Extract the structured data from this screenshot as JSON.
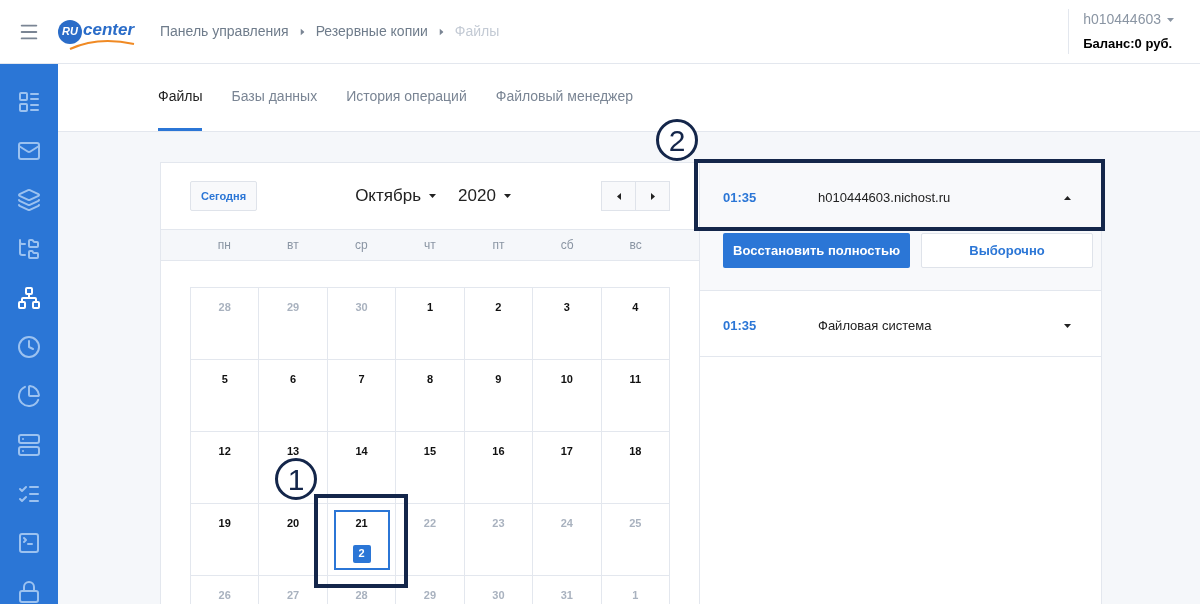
{
  "header": {
    "logo": {
      "badge": "RU",
      "word": "center"
    },
    "breadcrumbs": [
      {
        "label": "Панель управления",
        "current": false
      },
      {
        "label": "Резервные копии",
        "current": false
      },
      {
        "label": "Файлы",
        "current": true
      }
    ],
    "account": {
      "login": "h010444603",
      "balance": "Баланс:0 руб."
    }
  },
  "sidebar": {
    "items": [
      {
        "kind": "list",
        "selected": false
      },
      {
        "kind": "mail",
        "selected": false
      },
      {
        "kind": "layers",
        "selected": false
      },
      {
        "kind": "folder",
        "selected": false
      },
      {
        "kind": "network",
        "selected": true
      },
      {
        "kind": "clock",
        "selected": false
      },
      {
        "kind": "pie",
        "selected": false
      },
      {
        "kind": "server",
        "selected": false
      },
      {
        "kind": "form",
        "selected": false
      },
      {
        "kind": "terminal",
        "selected": false
      },
      {
        "kind": "lock",
        "selected": false
      }
    ]
  },
  "tabs": [
    {
      "label": "Файлы",
      "selected": true
    },
    {
      "label": "Базы данных",
      "selected": false
    },
    {
      "label": "История операций",
      "selected": false
    },
    {
      "label": "Файловый менеджер",
      "selected": false
    }
  ],
  "calendar": {
    "today_button": "Сегодня",
    "month": "Октябрь",
    "year": "2020",
    "weekdays": [
      "пн",
      "вт",
      "ср",
      "чт",
      "пт",
      "сб",
      "вс"
    ],
    "weeks": [
      [
        {
          "day": "28",
          "muted": true,
          "selected": false
        },
        {
          "day": "29",
          "muted": true,
          "selected": false
        },
        {
          "day": "30",
          "muted": true,
          "selected": false
        },
        {
          "day": "1",
          "muted": false,
          "selected": false
        },
        {
          "day": "2",
          "muted": false,
          "selected": false
        },
        {
          "day": "3",
          "muted": false,
          "selected": false
        },
        {
          "day": "4",
          "muted": false,
          "selected": false
        }
      ],
      [
        {
          "day": "5",
          "muted": false,
          "selected": false
        },
        {
          "day": "6",
          "muted": false,
          "selected": false
        },
        {
          "day": "7",
          "muted": false,
          "selected": false
        },
        {
          "day": "8",
          "muted": false,
          "selected": false
        },
        {
          "day": "9",
          "muted": false,
          "selected": false
        },
        {
          "day": "10",
          "muted": false,
          "selected": false
        },
        {
          "day": "11",
          "muted": false,
          "selected": false
        }
      ],
      [
        {
          "day": "12",
          "muted": false,
          "selected": false
        },
        {
          "day": "13",
          "muted": false,
          "selected": false
        },
        {
          "day": "14",
          "muted": false,
          "selected": false
        },
        {
          "day": "15",
          "muted": false,
          "selected": false
        },
        {
          "day": "16",
          "muted": false,
          "selected": false
        },
        {
          "day": "17",
          "muted": false,
          "selected": false
        },
        {
          "day": "18",
          "muted": false,
          "selected": false
        }
      ],
      [
        {
          "day": "19",
          "muted": false,
          "selected": false
        },
        {
          "day": "20",
          "muted": false,
          "selected": false
        },
        {
          "day": "21",
          "muted": false,
          "selected": true,
          "count": "2"
        },
        {
          "day": "22",
          "muted": true,
          "selected": false
        },
        {
          "day": "23",
          "muted": true,
          "selected": false
        },
        {
          "day": "24",
          "muted": true,
          "selected": false
        },
        {
          "day": "25",
          "muted": true,
          "selected": false
        }
      ],
      [
        {
          "day": "26",
          "muted": true,
          "selected": false
        },
        {
          "day": "27",
          "muted": true,
          "selected": false
        },
        {
          "day": "28",
          "muted": true,
          "selected": false
        },
        {
          "day": "29",
          "muted": true,
          "selected": false
        },
        {
          "day": "30",
          "muted": true,
          "selected": false
        },
        {
          "day": "31",
          "muted": true,
          "selected": false
        },
        {
          "day": "1",
          "muted": true,
          "selected": false
        }
      ]
    ]
  },
  "backups": [
    {
      "time": "01:35",
      "name": "h010444603.nichost.ru",
      "expanded": true,
      "actions": [
        "Восстановить полностью",
        "Выборочно"
      ]
    },
    {
      "time": "01:35",
      "name": "Файловая система",
      "expanded": false
    }
  ],
  "annotations": [
    {
      "label": "1"
    },
    {
      "label": "2"
    }
  ]
}
